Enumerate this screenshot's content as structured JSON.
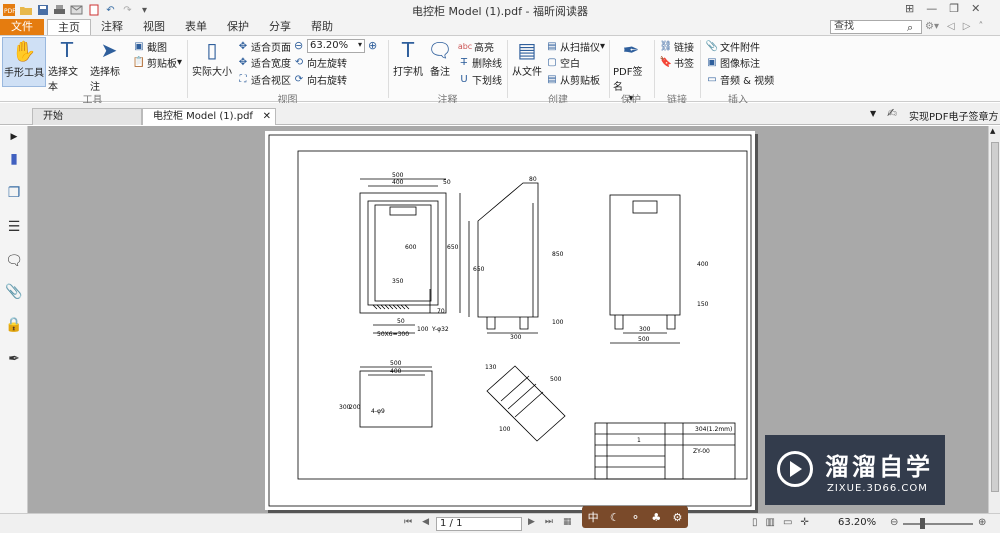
{
  "window": {
    "title": "电控柜 Model (1).pdf - 福昕阅读器"
  },
  "quick_access": [
    "pdf-logo-icon",
    "open-folder-icon",
    "save-icon",
    "print-icon",
    "email-icon",
    "new-doc-icon",
    "undo-icon",
    "redo-icon",
    "customize-icon"
  ],
  "tabs": [
    {
      "label": "文件"
    },
    {
      "label": "主页"
    },
    {
      "label": "注释"
    },
    {
      "label": "视图"
    },
    {
      "label": "表单"
    },
    {
      "label": "保护"
    },
    {
      "label": "分享"
    },
    {
      "label": "帮助"
    }
  ],
  "search": {
    "placeholder": "查找"
  },
  "ribbon": {
    "tools": {
      "hand": "手形工具",
      "select_text": "选择文本",
      "select_annotation": "选择标注",
      "screenshot": "截图",
      "clipboard": "剪贴板",
      "group": "工具"
    },
    "view": {
      "actual_size": "实际大小",
      "fit_page": "适合页面",
      "fit_width": "适合宽度",
      "fit_visible": "适合视区",
      "zoom": "63.20%",
      "rotate_left": "向左旋转",
      "rotate_right": "向右旋转",
      "group": "视图"
    },
    "comment": {
      "typewriter": "打字机",
      "note": "备注",
      "highlight": "高亮",
      "strikeout": "删除线",
      "underline": "下划线",
      "group": "注释",
      "highlight_badge": "abc"
    },
    "create": {
      "from_file": "从文件",
      "from_scanner": "从扫描仪",
      "blank": "空白",
      "from_clipboard": "从剪贴板",
      "group": "创建"
    },
    "protect": {
      "pdf_sign": "PDF签名",
      "group": "保护"
    },
    "links": {
      "link": "链接",
      "bookmark": "书签",
      "group": "链接"
    },
    "insert": {
      "file_attach": "文件附件",
      "image_annot": "图像标注",
      "audio_video": "音频 & 视频",
      "group": "插入"
    }
  },
  "doc_tabs": {
    "start": "开始",
    "current": "电控柜 Model (1).pdf",
    "promo": "实现PDF电子签章方案"
  },
  "drawing": {
    "dims_front": [
      "500",
      "400",
      "50",
      "600",
      "650",
      "350",
      "50",
      "100",
      "50X6=300",
      "70",
      "Y-φ32"
    ],
    "dims_side": [
      "80",
      "650",
      "850",
      "100",
      "300"
    ],
    "dims_back": [
      "400",
      "150",
      "300",
      "500"
    ],
    "dims_base": [
      "500",
      "400",
      "300",
      "200",
      "4-φ9"
    ],
    "dims_iso": [
      "130",
      "500",
      "100"
    ],
    "title_block": {
      "material": "304(1.2mm)",
      "qty": "1",
      "code": "ZY-00"
    }
  },
  "status": {
    "page": "1 / 1",
    "zoom": "63.20%"
  },
  "watermark": {
    "title": "溜溜自学",
    "url": "ZIXUE.3D66.COM"
  },
  "read_tools": [
    "中",
    "☾",
    "⚬",
    "♣",
    "⚙"
  ]
}
